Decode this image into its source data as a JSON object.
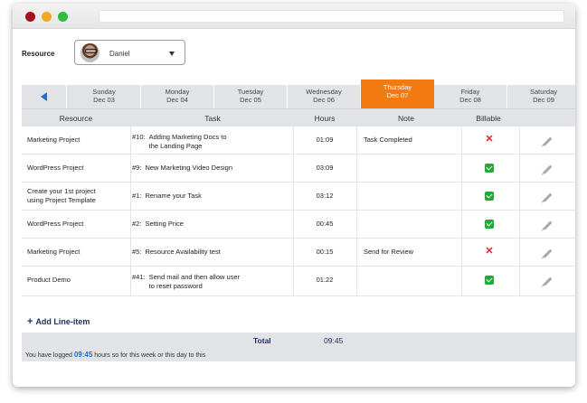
{
  "resource": {
    "label": "Resource",
    "selected": "Daniel"
  },
  "days": [
    {
      "day": "Sunday",
      "date": "Dec 03"
    },
    {
      "day": "Monday",
      "date": "Dec 04"
    },
    {
      "day": "Tuesday",
      "date": "Dec 05"
    },
    {
      "day": "Wednesday",
      "date": "Dec 06"
    },
    {
      "day": "Thursday",
      "date": "Dec 07",
      "active": true
    },
    {
      "day": "Friday",
      "date": "Dec 08"
    },
    {
      "day": "Saturday",
      "date": "Dec 09"
    }
  ],
  "columns": {
    "resource": "Resource",
    "task": "Task",
    "hours": "Hours",
    "note": "Note",
    "billable": "Billable"
  },
  "rows": [
    {
      "resource": "Marketing Project",
      "task_ref": "#10:",
      "task": "Adding Marketing Docs to\nthe Landing Page",
      "hours": "01:09",
      "note": "Task Completed",
      "billable": false
    },
    {
      "resource": "WordPress Project",
      "task_ref": "#9:",
      "task": "New Marketing Video Design",
      "hours": "03:09",
      "note": "",
      "billable": true
    },
    {
      "resource": "Create your 1st project\nusing Project Template",
      "task_ref": "#1:",
      "task": "Rename your Task",
      "hours": "03:12",
      "note": "",
      "billable": true
    },
    {
      "resource": "WordPress Project",
      "task_ref": "#2:",
      "task": "Setting Price",
      "hours": "00:45",
      "note": "",
      "billable": true
    },
    {
      "resource": "Marketing Project",
      "task_ref": "#5:",
      "task": "Resource Availability test",
      "hours": "00:15",
      "note": "Send for Review",
      "billable": false
    },
    {
      "resource": "Product Demo",
      "task_ref": "#41:",
      "task": "Send mail and then allow user\nto reset password",
      "hours": "01:22",
      "note": "",
      "billable": true
    }
  ],
  "add_line_label": "Add Line-item",
  "total": {
    "label": "Total",
    "value": "09:45"
  },
  "logged": {
    "prefix": "You have logged",
    "value": "09:45",
    "suffix": "hours so for this week or this day to this"
  },
  "colors": {
    "accent": "#f27a11",
    "link": "#1a73c9",
    "check": "#22a93a",
    "cross": "#e02020",
    "header_bg": "#e1e3e6"
  }
}
